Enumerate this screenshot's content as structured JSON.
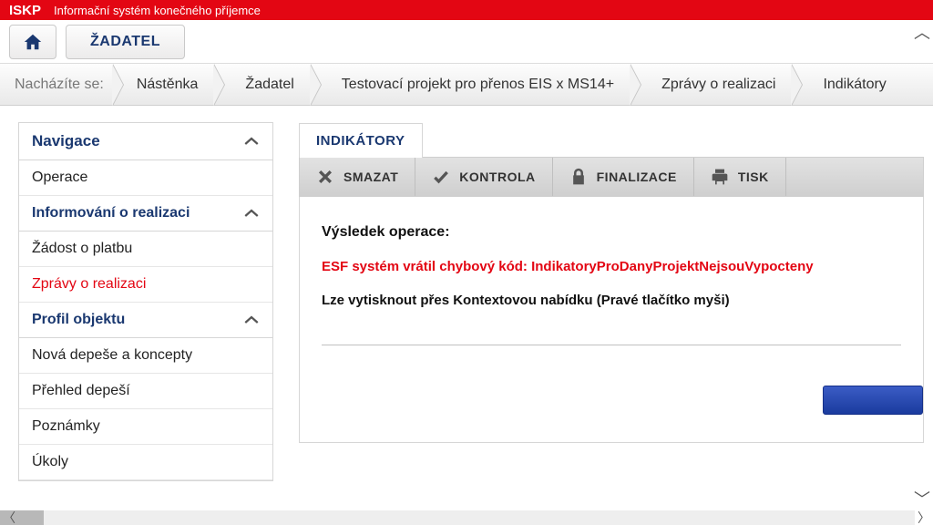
{
  "app": {
    "logo": "ISKP",
    "title": "Informační systém konečného příjemce"
  },
  "toolbar": {
    "applicant_label": "ŽADATEL"
  },
  "breadcrumb": {
    "label": "Nacházíte se:",
    "items": [
      "Nástěnka",
      "Žadatel",
      "Testovací projekt pro přenos EIS x MS14+",
      "Zprávy o realizaci",
      "Indikátory"
    ]
  },
  "sidebar": {
    "sections": {
      "navigace": {
        "title": "Navigace",
        "items": [
          "Operace"
        ]
      },
      "informovani": {
        "title": "Informování o realizaci",
        "items": [
          "Žádost o platbu",
          "Zprávy o realizaci"
        ],
        "active_index": 1
      },
      "profil": {
        "title": "Profil objektu",
        "items": [
          "Nová depeše a koncepty",
          "Přehled depeší",
          "Poznámky",
          "Úkoly"
        ]
      }
    }
  },
  "content": {
    "tab_title": "INDIKÁTORY",
    "actions": {
      "delete": "SMAZAT",
      "check": "KONTROLA",
      "finalize": "FINALIZACE",
      "print": "TISK"
    },
    "result_label": "Výsledek operace:",
    "error_message": "ESF systém vrátil chybový kód: IndikatoryProDanyProjektNejsouVypocteny",
    "print_note": "Lze vytisknout přes Kontextovou nabídku (Pravé tlačítko myši)"
  }
}
